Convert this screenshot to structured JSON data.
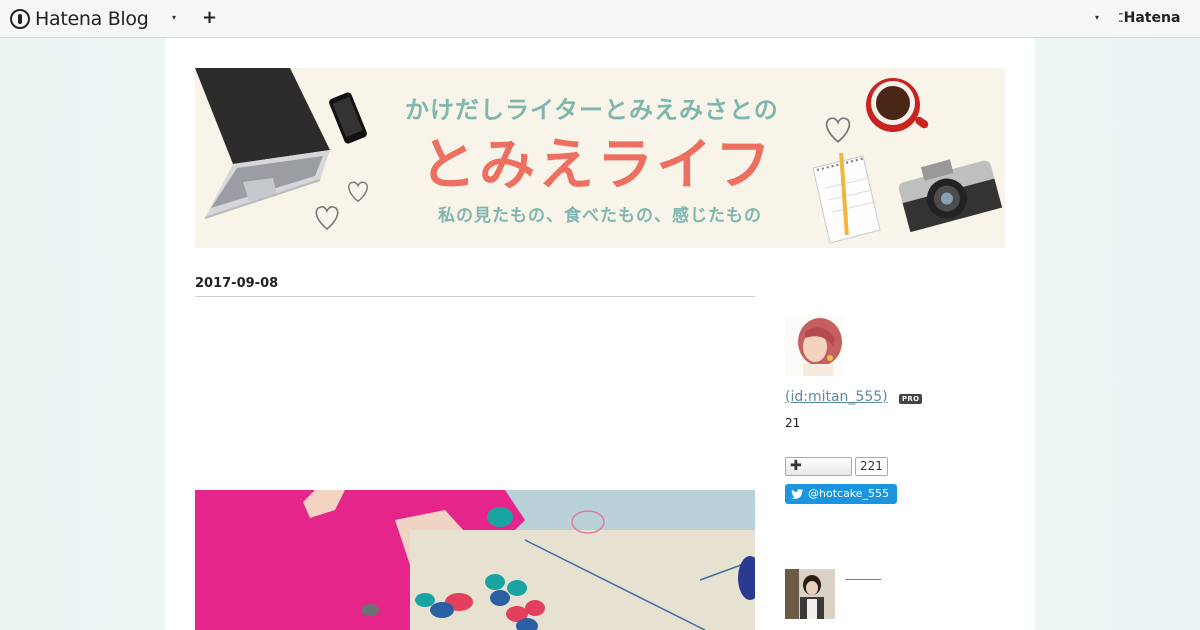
{
  "topbar": {
    "logo_text": "Hatena Blog",
    "caret_left": "▾",
    "plus": "+",
    "caret_right": "▾",
    "hatena_text": "Hatena"
  },
  "banner": {
    "subtitle": "かけだしライターとみえみさとの",
    "title": "とみえライフ",
    "tagline": "私の見たもの、食べたもの、感じたもの"
  },
  "entry": {
    "date": "2017-09-08"
  },
  "sidebar": {
    "profile_link": " (id:mitan_555)",
    "pro_badge": "PRO",
    "count": "21",
    "subscribe_icon": "✚",
    "subscribe_count": "221",
    "twitter_label": "@hotcake_555"
  },
  "colors": {
    "banner_coral": "#ed6f5f",
    "banner_teal": "#7fb6ad",
    "link": "#5a8aa0",
    "twitter": "#1b95e0"
  },
  "icons": [
    "hatena-blog-logo-icon",
    "chevron-down-icon",
    "plus-icon",
    "hatena-logo-icon",
    "twitter-bird-icon"
  ]
}
